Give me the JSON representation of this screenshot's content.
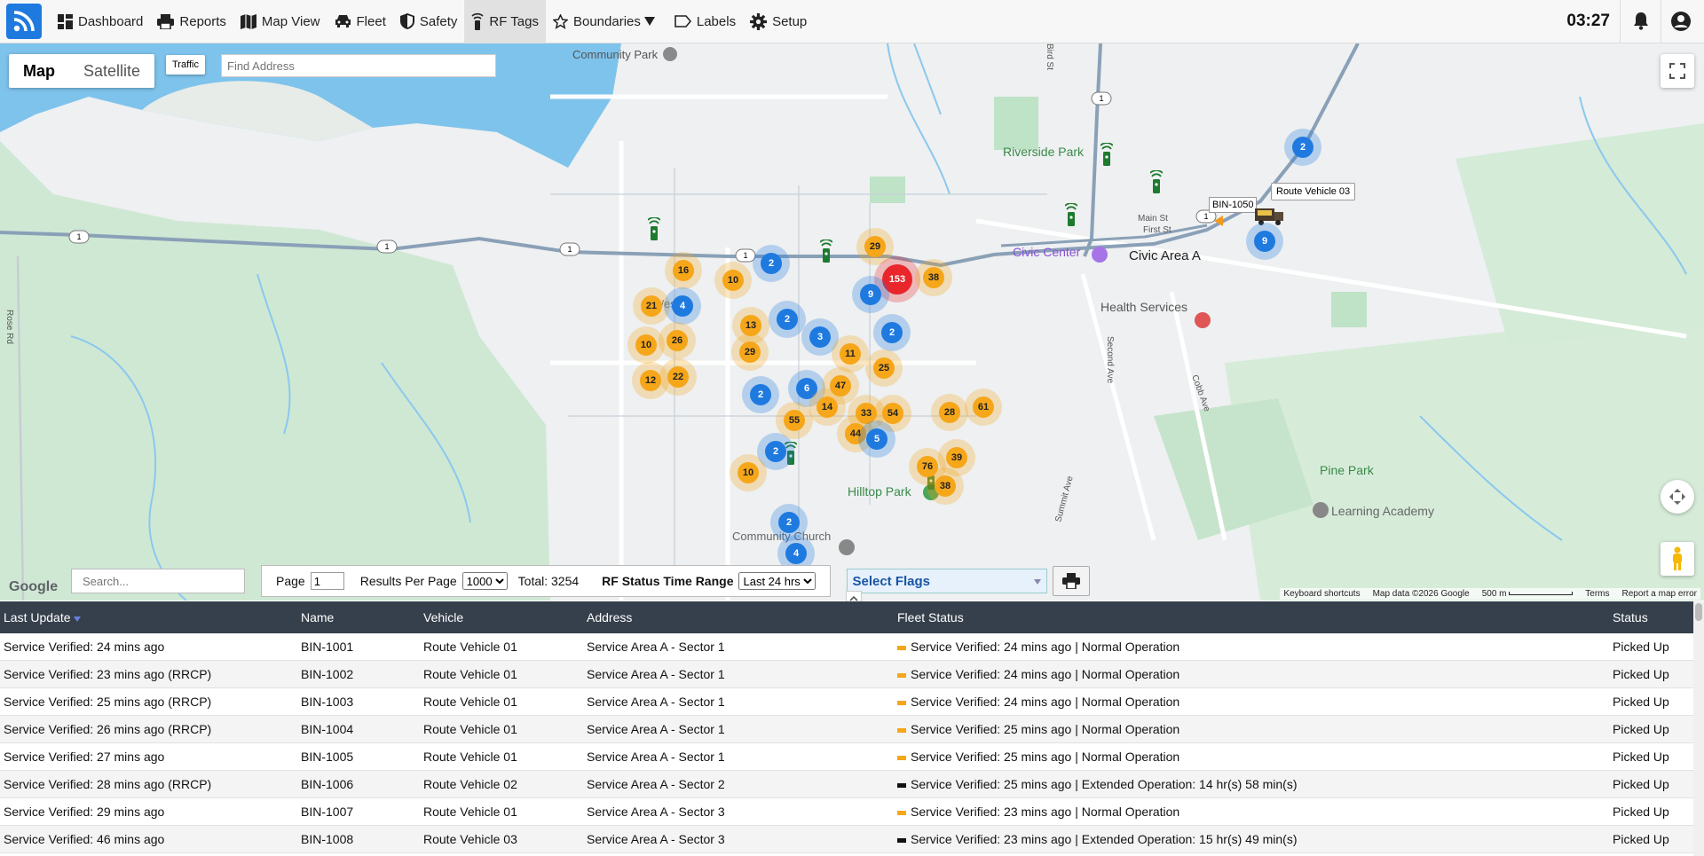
{
  "nav": {
    "items": [
      {
        "label": "Dashboard",
        "icon": "dashboard-icon"
      },
      {
        "label": "Reports",
        "icon": "printer-icon"
      },
      {
        "label": "Map View",
        "icon": "map-icon"
      },
      {
        "label": "Fleet",
        "icon": "car-icon"
      },
      {
        "label": "Safety",
        "icon": "shield-icon"
      },
      {
        "label": "RF Tags",
        "icon": "rf-tag-icon"
      },
      {
        "label": "Boundaries",
        "icon": "star-icon"
      },
      {
        "label": "Labels",
        "icon": "label-icon"
      },
      {
        "label": "Setup",
        "icon": "gear-icon"
      }
    ],
    "active": "RF Tags",
    "clock": "03:27"
  },
  "map": {
    "type_options": [
      "Map",
      "Satellite"
    ],
    "type_selected": "Map",
    "traffic_label": "Traffic",
    "address_placeholder": "Find Address",
    "places": {
      "community_park": "Community Park",
      "riverside_park": "Riverside\nPark",
      "civic_center": "Civic Center",
      "civic_area": "Civic Area A",
      "health_services": "Health Services",
      "pine_park": "Pine Park",
      "learning_academy": "Learning Academy",
      "hilltop_park": "Hilltop Park",
      "community_church": "Community Church",
      "main_st": "Main St",
      "first_st": "First St",
      "second_ave": "Second Ave",
      "cobb_ave": "Cobb Ave",
      "summit_ave": "Summit Ave",
      "rose_rd": "Rose Rd",
      "bird_st": "Bird St",
      "west": "West"
    },
    "route_shield": "1",
    "vehicle_label": "Route Vehicle 03",
    "bin_label": "BIN-1050",
    "clusters": [
      {
        "n": "16",
        "c": "orange"
      },
      {
        "n": "10",
        "c": "orange"
      },
      {
        "n": "2",
        "c": "blue"
      },
      {
        "n": "29",
        "c": "orange"
      },
      {
        "n": "153",
        "c": "red"
      },
      {
        "n": "38",
        "c": "orange"
      },
      {
        "n": "21",
        "c": "orange"
      },
      {
        "n": "4",
        "c": "blue"
      },
      {
        "n": "9",
        "c": "blue"
      },
      {
        "n": "10",
        "c": "orange"
      },
      {
        "n": "26",
        "c": "orange"
      },
      {
        "n": "13",
        "c": "orange"
      },
      {
        "n": "2",
        "c": "blue"
      },
      {
        "n": "3",
        "c": "blue"
      },
      {
        "n": "2",
        "c": "blue"
      },
      {
        "n": "29",
        "c": "orange"
      },
      {
        "n": "11",
        "c": "orange"
      },
      {
        "n": "25",
        "c": "orange"
      },
      {
        "n": "12",
        "c": "orange"
      },
      {
        "n": "22",
        "c": "orange"
      },
      {
        "n": "2",
        "c": "blue"
      },
      {
        "n": "6",
        "c": "blue"
      },
      {
        "n": "47",
        "c": "orange"
      },
      {
        "n": "14",
        "c": "orange"
      },
      {
        "n": "33",
        "c": "orange"
      },
      {
        "n": "54",
        "c": "orange"
      },
      {
        "n": "28",
        "c": "orange"
      },
      {
        "n": "61",
        "c": "orange"
      },
      {
        "n": "55",
        "c": "orange"
      },
      {
        "n": "44",
        "c": "orange"
      },
      {
        "n": "5",
        "c": "blue"
      },
      {
        "n": "2",
        "c": "blue"
      },
      {
        "n": "76",
        "c": "orange"
      },
      {
        "n": "39",
        "c": "orange"
      },
      {
        "n": "10",
        "c": "orange"
      },
      {
        "n": "38",
        "c": "orange"
      },
      {
        "n": "2",
        "c": "blue"
      },
      {
        "n": "4",
        "c": "blue"
      },
      {
        "n": "2",
        "c": "blue"
      },
      {
        "n": "9",
        "c": "blue"
      }
    ],
    "google": "Google",
    "attribution": [
      "Keyboard shortcuts",
      "Map data ©2026 Google",
      "500 m",
      "Terms",
      "Report a map error"
    ]
  },
  "toolbar": {
    "search_placeholder": "Search...",
    "page_label": "Page",
    "page_value": "1",
    "results_label": "Results Per Page",
    "results_value": "1000",
    "total_label": "Total: 3254",
    "rf_range_label": "RF Status Time Range",
    "rf_range_value": "Last 24 hrs",
    "flags_placeholder": "Select Flags"
  },
  "colors": {
    "orange": "#f6a619",
    "blue": "#1f7ae0",
    "red": "#e8262b",
    "header": "#36404c"
  },
  "table": {
    "columns": [
      "Last Update",
      "Name",
      "Vehicle",
      "Address",
      "Fleet Status",
      "Status"
    ],
    "rows": [
      [
        "Service Verified: 24 mins ago",
        "BIN-1001",
        "Route Vehicle 01",
        "Service Area A - Sector 1",
        "Service Verified: 24 mins ago | Normal Operation",
        "Picked Up",
        "orange"
      ],
      [
        "Service Verified: 23 mins ago (RRCP)",
        "BIN-1002",
        "Route Vehicle 01",
        "Service Area A - Sector 1",
        "Service Verified: 24 mins ago | Normal Operation",
        "Picked Up",
        "orange"
      ],
      [
        "Service Verified: 25 mins ago (RRCP)",
        "BIN-1003",
        "Route Vehicle 01",
        "Service Area A - Sector 1",
        "Service Verified: 24 mins ago | Normal Operation",
        "Picked Up",
        "orange"
      ],
      [
        "Service Verified: 26 mins ago (RRCP)",
        "BIN-1004",
        "Route Vehicle 01",
        "Service Area A - Sector 1",
        "Service Verified: 25 mins ago | Normal Operation",
        "Picked Up",
        "orange"
      ],
      [
        "Service Verified: 27 mins ago",
        "BIN-1005",
        "Route Vehicle 01",
        "Service Area A - Sector 1",
        "Service Verified: 25 mins ago | Normal Operation",
        "Picked Up",
        "orange"
      ],
      [
        "Service Verified: 28 mins ago (RRCP)",
        "BIN-1006",
        "Route Vehicle 02",
        "Service Area A - Sector 2",
        "Service Verified: 25 mins ago | Extended Operation: 14 hr(s) 58 min(s)",
        "Picked Up",
        "black"
      ],
      [
        "Service Verified: 29 mins ago",
        "BIN-1007",
        "Route Vehicle 01",
        "Service Area A - Sector 3",
        "Service Verified: 23 mins ago | Normal Operation",
        "Picked Up",
        "orange"
      ],
      [
        "Service Verified: 46 mins ago",
        "BIN-1008",
        "Route Vehicle 03",
        "Service Area A - Sector 3",
        "Service Verified: 23 mins ago | Extended Operation: 15 hr(s) 49 min(s)",
        "Picked Up",
        "black"
      ]
    ]
  }
}
